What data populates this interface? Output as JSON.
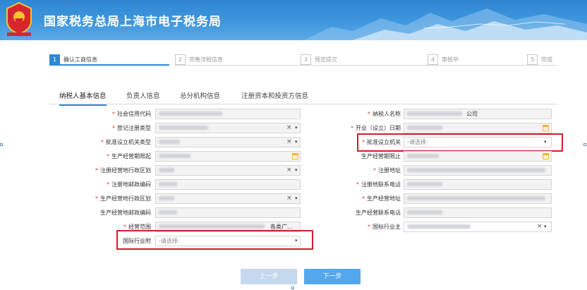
{
  "header": {
    "title": "国家税务总局上海市电子税务局"
  },
  "steps": [
    {
      "num": "1",
      "label": "确认工商信息",
      "active": true
    },
    {
      "num": "2",
      "label": "完善涉税信息",
      "active": false
    },
    {
      "num": "3",
      "label": "预览提交",
      "active": false
    },
    {
      "num": "4",
      "label": "审核中",
      "active": false
    },
    {
      "num": "5",
      "label": "完成",
      "active": false
    }
  ],
  "tabs": [
    "纳税人基本信息",
    "负责人信息",
    "总分机构信息",
    "注册资本和投资方信息"
  ],
  "left_fields": [
    {
      "label": "社会信用代码",
      "required": true
    },
    {
      "label": "登记注册类型",
      "required": true
    },
    {
      "label": "批准设立机关类型",
      "required": true
    },
    {
      "label": "生产经营期限起",
      "required": true
    },
    {
      "label": "注册经营地行政区划",
      "required": true
    },
    {
      "label": "注册地邮政编码",
      "required": true
    },
    {
      "label": "生产经营地行政区划",
      "required": true
    },
    {
      "label": "生产经营地邮政编码",
      "required": false
    },
    {
      "label": "经营范围",
      "required": true,
      "value_suffix": "各类广..."
    },
    {
      "label": "国际行业附",
      "required": false,
      "placeholder": "-请选择-"
    }
  ],
  "right_fields": [
    {
      "label": "纳税人名称",
      "required": true,
      "value_suffix": "公司"
    },
    {
      "label": "开业（设立）日期",
      "required": true
    },
    {
      "label": "批准设立机关",
      "required": true,
      "placeholder": "-请选择-"
    },
    {
      "label": "生产经营期限止",
      "required": false
    },
    {
      "label": "注册地址",
      "required": true
    },
    {
      "label": "注册地联系电话",
      "required": true
    },
    {
      "label": "生产经营地址",
      "required": true
    },
    {
      "label": "生产经营联系电话",
      "required": false
    },
    {
      "label": "国标行业主",
      "required": true
    }
  ],
  "symbols": {
    "clear": "×",
    "caret": "▾",
    "asterisk": "*"
  },
  "buttons": {
    "prev": "上一步",
    "next": "下一步"
  },
  "colors": {
    "accent": "#2b88d8",
    "highlight": "#d21c2a",
    "required": "#e23b3b"
  }
}
